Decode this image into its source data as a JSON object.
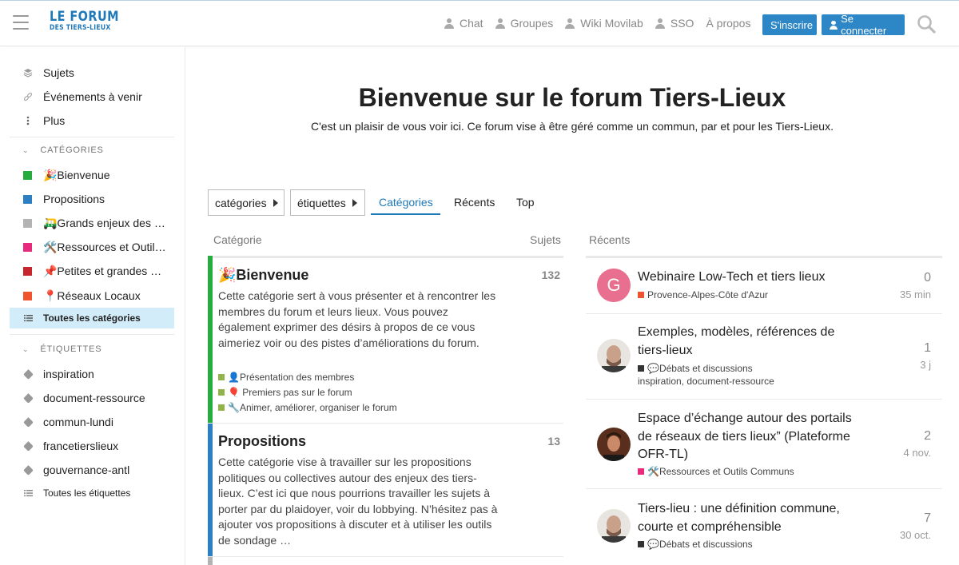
{
  "header": {
    "logo_line1": "LE FORUM",
    "logo_line2": "DES TIERS-LIEUX",
    "nav": [
      "Chat",
      "Groupes",
      "Wiki Movilab",
      "SSO",
      "À propos"
    ],
    "signup": "S'inscrire",
    "login": "Se connecter",
    "brand_color": "#2d86c6"
  },
  "sidebar": {
    "top": [
      {
        "label": "Sujets",
        "icon": "layers-icon"
      },
      {
        "label": "Événements à venir",
        "icon": "link-icon"
      },
      {
        "label": "Plus",
        "icon": "more-vertical-icon"
      }
    ],
    "categories_title": "CATÉGORIES",
    "categories": [
      {
        "label": "🎉Bienvenue",
        "color": "#25ab3e"
      },
      {
        "label": "Propositions",
        "color": "#2d7fc4"
      },
      {
        "label": "🛺Grands enjeux des tiers-lieux",
        "color": "#b3b3b3"
      },
      {
        "label": "🛠️Ressources et Outils Communs",
        "color": "#e9297b"
      },
      {
        "label": "📌Petites et grandes annonces",
        "color": "#c8262d"
      },
      {
        "label": "📍Réseaux Locaux",
        "color": "#f0542e"
      }
    ],
    "all_categories": "Toutes les catégories",
    "tags_title": "ÉTIQUETTES",
    "tags": [
      "inspiration",
      "document-ressource",
      "commun-lundi",
      "francetierslieux",
      "gouvernance-antl"
    ],
    "all_tags": "Toutes les étiquettes"
  },
  "main": {
    "title": "Bienvenue sur le forum Tiers-Lieux",
    "subtitle": "C'est un plaisir de vous voir ici. Ce forum vise à être géré comme un commun, par et pour les Tiers-Lieux.",
    "dropdowns": [
      "catégories",
      "étiquettes"
    ],
    "tabs": [
      "Catégories",
      "Récents",
      "Top"
    ],
    "col_category": "Catégorie",
    "col_topics": "Sujets",
    "col_recent": "Récents",
    "categories": [
      {
        "name": "🎉Bienvenue",
        "count": "132",
        "color": "#25ab3e",
        "desc": "Cette catégorie sert à vous présenter et à rencontrer les membres du forum et leurs lieux. Vous pouvez également exprimer des désirs à propos de ce vous aimeriez voir ou des pistes d’améliorations du forum.",
        "subs": [
          "👤Présentation des membres",
          "🎈 Premiers pas sur le forum",
          "🔧Animer, améliorer, organiser le forum"
        ]
      },
      {
        "name": "Propositions",
        "count": "13",
        "color": "#2d7fc4",
        "desc": "Cette catégorie vise à travailler sur les propositions politiques ou collectives autour des enjeux des tiers-lieux. C’est ici que nous pourrions travailler les sujets à porter par du plaidoyer, voir du lobbying. N’hésitez pas à ajouter vos propositions à discuter et à utiliser les outils de sondage …"
      }
    ],
    "topics": [
      {
        "title": "Webinaire Low-Tech et tiers lieux",
        "category": "Provence-Alpes-Côte d'Azur",
        "cat_color": "#f0542e",
        "replies": "0",
        "age": "35 min",
        "avatar_letter": "G"
      },
      {
        "title": "Exemples, modèles, références de tiers-lieux",
        "category": "💬Débats et discussions",
        "cat_color": "#333333",
        "tags": "inspiration, document-ressource",
        "replies": "1",
        "age": "3 j"
      },
      {
        "title": "Espace d’échange autour des portails de réseaux de tiers lieux” (Plateforme OFR-TL)",
        "category": "🛠️Ressources et Outils Communs",
        "cat_color": "#e9297b",
        "replies": "2",
        "age": "4 nov."
      },
      {
        "title": "Tiers-lieu : une définition commune, courte et compréhensible",
        "category": "💬Débats et discussions",
        "cat_color": "#333333",
        "replies": "7",
        "age": "30 oct."
      }
    ]
  }
}
